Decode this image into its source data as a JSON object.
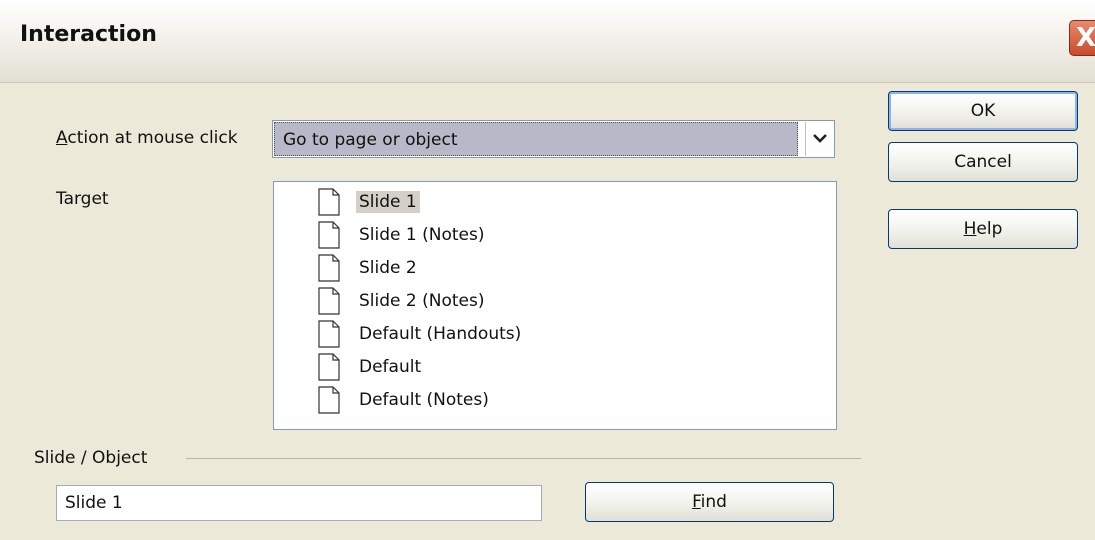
{
  "window": {
    "title": "Interaction",
    "close_glyph": "X"
  },
  "action": {
    "label_first": "A",
    "label_rest": "ction at mouse click",
    "selected": "Go to page or object"
  },
  "target": {
    "label": "Target",
    "items": [
      {
        "label": "Slide 1",
        "selected": true
      },
      {
        "label": "Slide 1 (Notes)",
        "selected": false
      },
      {
        "label": "Slide 2",
        "selected": false
      },
      {
        "label": "Slide 2 (Notes)",
        "selected": false
      },
      {
        "label": "Default (Handouts)",
        "selected": false
      },
      {
        "label": "Default",
        "selected": false
      },
      {
        "label": "Default (Notes)",
        "selected": false
      }
    ]
  },
  "slide_object": {
    "label": "Slide / Object",
    "value": "Slide 1"
  },
  "buttons": {
    "ok": "OK",
    "cancel": "Cancel",
    "help_first": "H",
    "help_rest": "elp",
    "find_first": "F",
    "find_rest": "ind"
  }
}
